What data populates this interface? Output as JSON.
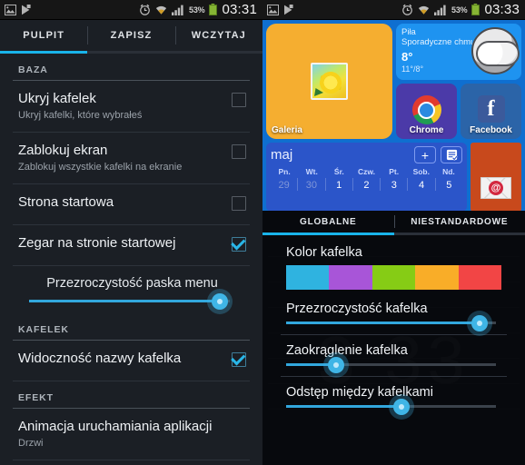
{
  "left_screen": {
    "statusbar": {
      "icons_left": [
        "image-icon",
        "playstore-icon"
      ],
      "icons_right": [
        "alarm-icon",
        "wifi-icon",
        "signal-icon"
      ],
      "battery_pct": "53%",
      "time": "03:31"
    },
    "tabs": [
      {
        "label": "PULPIT",
        "active": true
      },
      {
        "label": "ZAPISZ",
        "active": false
      },
      {
        "label": "WCZYTAJ",
        "active": false
      }
    ],
    "sections": [
      {
        "header": "BAZA",
        "rows": [
          {
            "title": "Ukryj kafelek",
            "sub": "Ukryj kafelki, które wybrałeś",
            "checked": false
          },
          {
            "title": "Zablokuj ekran",
            "sub": "Zablokuj wszystkie kafelki na ekranie",
            "checked": false
          },
          {
            "title": "Strona startowa",
            "sub": "",
            "checked": false
          },
          {
            "title": "Zegar na stronie startowej",
            "sub": "",
            "checked": true
          }
        ],
        "slider": {
          "label": "Przezroczystość paska menu",
          "value": 95
        }
      },
      {
        "header": "KAFELEK",
        "rows": [
          {
            "title": "Widoczność nazwy kafelka",
            "sub": "",
            "checked": true
          }
        ]
      },
      {
        "header": "EFEKT",
        "rows": [
          {
            "title": "Animacja uruchamiania aplikacji",
            "sub": "Drzwi",
            "checked": null
          }
        ]
      }
    ]
  },
  "right_screen": {
    "statusbar": {
      "battery_pct": "53%",
      "time": "03:33"
    },
    "home": {
      "gallery_tile": {
        "label": "Galeria",
        "icon": "photo-icon",
        "color": "#f5ae30"
      },
      "weather_tile": {
        "city": "Piła",
        "condition": "Sporadyczne chmury",
        "temp": "8°",
        "range": "11°/8°",
        "icon": "cloudy-night-icon"
      },
      "chrome_tile": {
        "label": "Chrome",
        "icon": "chrome-icon",
        "color": "#4b3aa8"
      },
      "facebook_tile": {
        "label": "Facebook",
        "icon": "facebook-icon",
        "color": "#2b64a8"
      },
      "calendar_tile": {
        "month": "maj",
        "add_button": "+",
        "list_button": "agenda-icon",
        "dow": [
          "Pn.",
          "Wt.",
          "Śr.",
          "Czw.",
          "Pt.",
          "Sob.",
          "Nd."
        ],
        "days": [
          "29",
          "30",
          "1",
          "2",
          "3",
          "4",
          "5"
        ],
        "dim_days": [
          "29",
          "30"
        ]
      },
      "mail_tile": {
        "icon": "email-icon",
        "color": "#c8491c"
      }
    },
    "wallpaper": {
      "clock": "3 33"
    },
    "overlay": {
      "tabs": [
        {
          "label": "GLOBALNE",
          "active": true
        },
        {
          "label": "NIESTANDARDOWE",
          "active": false
        }
      ],
      "color_label": "Kolor kafelka",
      "swatches": [
        "#2fb3e0",
        "#a855d8",
        "#86cc15",
        "#f9ad28",
        "#f24545"
      ],
      "sliders": [
        {
          "label": "Przezroczystość kafelka",
          "value": 92
        },
        {
          "label": "Zaokrąglenie kafelka",
          "value": 24
        },
        {
          "label": "Odstęp między kafelkami",
          "value": 55
        }
      ]
    }
  },
  "colors": {
    "accent": "#19b4ea",
    "panel_bg": "#1b1f25",
    "statusbar_bg": "#161616"
  }
}
